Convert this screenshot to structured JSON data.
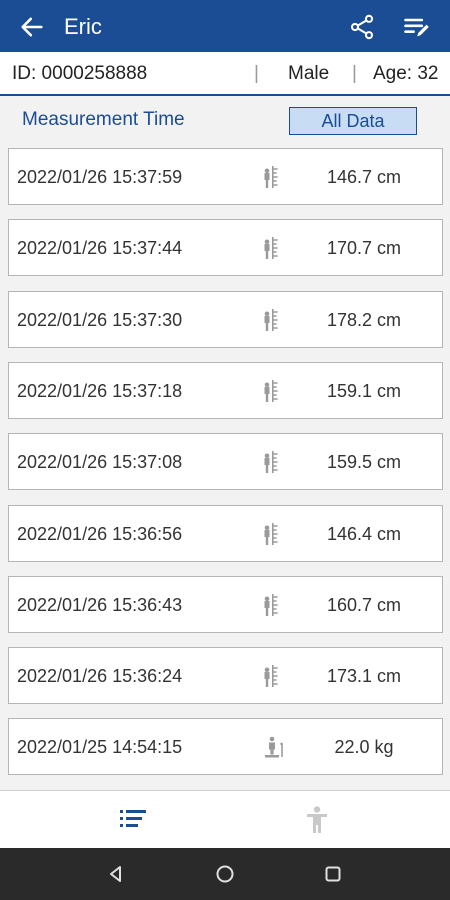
{
  "appbar": {
    "title": "Eric",
    "back_icon": "arrow-left-icon",
    "share_icon": "share-icon",
    "edit_icon": "edit-list-icon"
  },
  "profile": {
    "id": "ID: 0000258888",
    "separator": "|",
    "gender": "Male",
    "age": "Age: 32"
  },
  "filter": {
    "label": "Measurement Time",
    "button": "All Data"
  },
  "records": [
    {
      "time": "2022/01/26 15:37:59",
      "icon": "height-measure-icon",
      "value": "146.7 cm"
    },
    {
      "time": "2022/01/26 15:37:44",
      "icon": "height-measure-icon",
      "value": "170.7 cm"
    },
    {
      "time": "2022/01/26 15:37:30",
      "icon": "height-measure-icon",
      "value": "178.2 cm"
    },
    {
      "time": "2022/01/26 15:37:18",
      "icon": "height-measure-icon",
      "value": "159.1 cm"
    },
    {
      "time": "2022/01/26 15:37:08",
      "icon": "height-measure-icon",
      "value": "159.5 cm"
    },
    {
      "time": "2022/01/26 15:36:56",
      "icon": "height-measure-icon",
      "value": "146.4 cm"
    },
    {
      "time": "2022/01/26 15:36:43",
      "icon": "height-measure-icon",
      "value": "160.7 cm"
    },
    {
      "time": "2022/01/26 15:36:24",
      "icon": "height-measure-icon",
      "value": "173.1 cm"
    },
    {
      "time": "2022/01/25 14:54:15",
      "icon": "weight-scale-icon",
      "value": "22.0 kg"
    }
  ],
  "bottom_nav": {
    "list_icon": "list-icon",
    "body_icon": "person-icon"
  },
  "colors": {
    "primary": "#1a4d94",
    "selected_bg": "#c8dcf3",
    "icon_gray": "#9a9a9a"
  }
}
